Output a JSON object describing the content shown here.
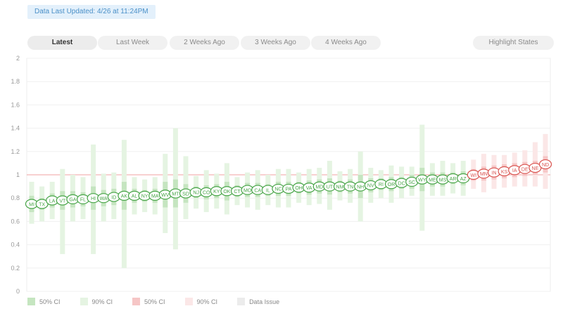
{
  "last_updated": "Data Last Updated: 4/26 at 11:24PM",
  "tabs": [
    {
      "label": "Latest",
      "active": true
    },
    {
      "label": "Last Week",
      "active": false
    },
    {
      "label": "2 Weeks Ago",
      "active": false
    },
    {
      "label": "3 Weeks Ago",
      "active": false
    },
    {
      "label": "4 Weeks Ago",
      "active": false
    }
  ],
  "highlight_label": "Highlight States",
  "legend": [
    {
      "label": "50% CI",
      "color": "#c5e5c0"
    },
    {
      "label": "90% CI",
      "color": "#e5f4e2"
    },
    {
      "label": "50% CI",
      "color": "#f6c6c6"
    },
    {
      "label": "90% CI",
      "color": "#fbe7e7"
    },
    {
      "label": "Data Issue",
      "color": "#ececec"
    }
  ],
  "colors": {
    "below": "#47a447",
    "above": "#d9534f",
    "reference": "#f0a0a0"
  },
  "chart_data": {
    "type": "scatter",
    "title": "",
    "xlabel": "",
    "ylabel": "",
    "ylim": [
      0,
      2
    ],
    "yticks": [
      0,
      0.2,
      0.4,
      0.6,
      0.8,
      1,
      1.2,
      1.4,
      1.6,
      1.8,
      2
    ],
    "reference_line": 1,
    "grid": true,
    "states": [
      "MI",
      "TX",
      "LA",
      "VT",
      "GA",
      "FL",
      "HI",
      "WA",
      "ID",
      "AK",
      "AL",
      "NY",
      "MA",
      "WV",
      "MT",
      "SD",
      "NJ",
      "CO",
      "KY",
      "OK",
      "CT",
      "MO",
      "CA",
      "IL",
      "NC",
      "PA",
      "OH",
      "VA",
      "MD",
      "UT",
      "NM",
      "TN",
      "NH",
      "NV",
      "RI",
      "OR",
      "DC",
      "SC",
      "WY",
      "ME",
      "MS",
      "AR",
      "AZ",
      "WI",
      "MN",
      "IN",
      "KS",
      "IA",
      "DE",
      "NE",
      "ND"
    ],
    "values": [
      0.75,
      0.75,
      0.78,
      0.78,
      0.79,
      0.79,
      0.8,
      0.8,
      0.81,
      0.82,
      0.82,
      0.82,
      0.82,
      0.83,
      0.84,
      0.84,
      0.85,
      0.85,
      0.86,
      0.86,
      0.86,
      0.87,
      0.87,
      0.87,
      0.88,
      0.88,
      0.89,
      0.89,
      0.9,
      0.9,
      0.9,
      0.9,
      0.9,
      0.91,
      0.92,
      0.92,
      0.93,
      0.94,
      0.96,
      0.96,
      0.96,
      0.97,
      0.97,
      1.0,
      1.01,
      1.02,
      1.03,
      1.04,
      1.05,
      1.06,
      1.09
    ],
    "ci50": [
      [
        0.68,
        0.82
      ],
      [
        0.7,
        0.8
      ],
      [
        0.72,
        0.84
      ],
      [
        0.7,
        0.86
      ],
      [
        0.72,
        0.86
      ],
      [
        0.73,
        0.85
      ],
      [
        0.7,
        0.9
      ],
      [
        0.73,
        0.87
      ],
      [
        0.74,
        0.88
      ],
      [
        0.7,
        0.94
      ],
      [
        0.76,
        0.88
      ],
      [
        0.77,
        0.87
      ],
      [
        0.76,
        0.88
      ],
      [
        0.72,
        0.94
      ],
      [
        0.72,
        0.96
      ],
      [
        0.76,
        0.92
      ],
      [
        0.8,
        0.9
      ],
      [
        0.79,
        0.91
      ],
      [
        0.8,
        0.92
      ],
      [
        0.78,
        0.94
      ],
      [
        0.81,
        0.91
      ],
      [
        0.81,
        0.93
      ],
      [
        0.81,
        0.93
      ],
      [
        0.82,
        0.92
      ],
      [
        0.82,
        0.94
      ],
      [
        0.82,
        0.94
      ],
      [
        0.84,
        0.94
      ],
      [
        0.83,
        0.95
      ],
      [
        0.84,
        0.96
      ],
      [
        0.83,
        0.97
      ],
      [
        0.85,
        0.95
      ],
      [
        0.84,
        0.96
      ],
      [
        0.8,
        1.0
      ],
      [
        0.85,
        0.97
      ],
      [
        0.87,
        0.97
      ],
      [
        0.86,
        0.98
      ],
      [
        0.88,
        0.98
      ],
      [
        0.88,
        1.0
      ],
      [
        0.86,
        1.06
      ],
      [
        0.9,
        1.02
      ],
      [
        0.9,
        1.02
      ],
      [
        0.92,
        1.02
      ],
      [
        0.91,
        1.03
      ],
      [
        0.95,
        1.05
      ],
      [
        0.95,
        1.07
      ],
      [
        0.96,
        1.08
      ],
      [
        0.97,
        1.09
      ],
      [
        0.98,
        1.1
      ],
      [
        0.99,
        1.11
      ],
      [
        1.0,
        1.12
      ],
      [
        1.02,
        1.16
      ]
    ],
    "ci90": [
      [
        0.58,
        0.94
      ],
      [
        0.6,
        0.9
      ],
      [
        0.62,
        0.94
      ],
      [
        0.32,
        1.05
      ],
      [
        0.6,
        1.0
      ],
      [
        0.62,
        0.98
      ],
      [
        0.32,
        1.26
      ],
      [
        0.6,
        1.01
      ],
      [
        0.62,
        1.02
      ],
      [
        0.2,
        1.3
      ],
      [
        0.66,
        0.98
      ],
      [
        0.68,
        0.96
      ],
      [
        0.66,
        0.98
      ],
      [
        0.5,
        1.18
      ],
      [
        0.36,
        1.4
      ],
      [
        0.62,
        1.16
      ],
      [
        0.71,
        0.99
      ],
      [
        0.68,
        1.04
      ],
      [
        0.71,
        1.01
      ],
      [
        0.66,
        1.1
      ],
      [
        0.74,
        0.98
      ],
      [
        0.72,
        1.02
      ],
      [
        0.7,
        1.04
      ],
      [
        0.74,
        1.0
      ],
      [
        0.72,
        1.05
      ],
      [
        0.72,
        1.05
      ],
      [
        0.76,
        1.02
      ],
      [
        0.74,
        1.05
      ],
      [
        0.75,
        1.06
      ],
      [
        0.7,
        1.12
      ],
      [
        0.78,
        1.03
      ],
      [
        0.76,
        1.05
      ],
      [
        0.6,
        1.2
      ],
      [
        0.76,
        1.06
      ],
      [
        0.8,
        1.04
      ],
      [
        0.76,
        1.08
      ],
      [
        0.8,
        1.07
      ],
      [
        0.82,
        1.07
      ],
      [
        0.52,
        1.43
      ],
      [
        0.82,
        1.1
      ],
      [
        0.82,
        1.12
      ],
      [
        0.84,
        1.1
      ],
      [
        0.82,
        1.12
      ],
      [
        0.88,
        1.13
      ],
      [
        0.85,
        1.18
      ],
      [
        0.88,
        1.17
      ],
      [
        0.89,
        1.17
      ],
      [
        0.9,
        1.19
      ],
      [
        0.9,
        1.21
      ],
      [
        0.9,
        1.28
      ],
      [
        0.88,
        1.35
      ]
    ]
  }
}
